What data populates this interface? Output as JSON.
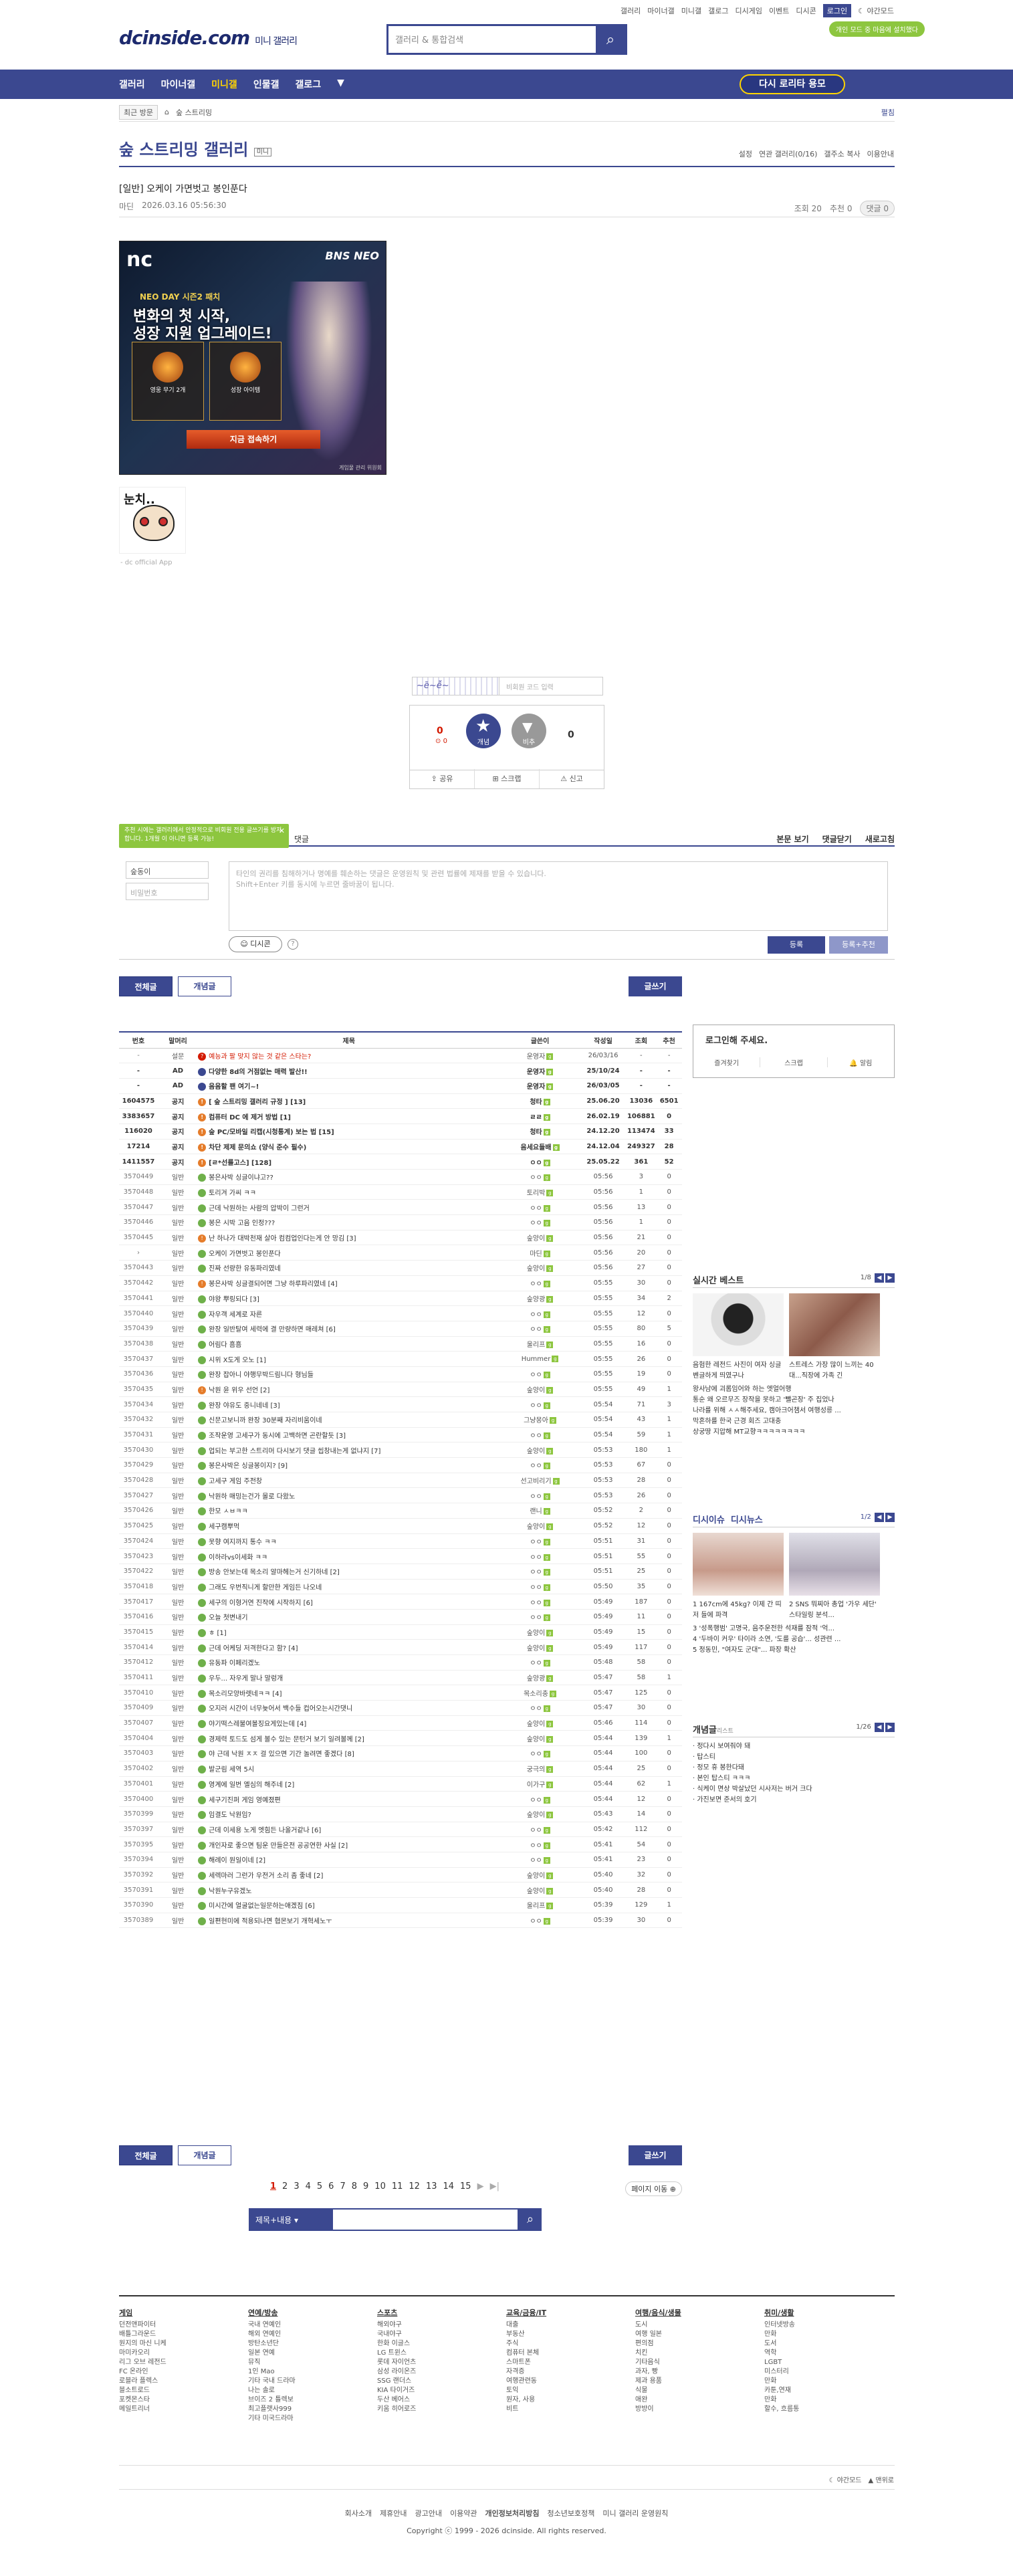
{
  "util": {
    "links": [
      "갤러리",
      "마이너갤",
      "미니갤",
      "갤로그",
      "디시게임",
      "이벤트",
      "디시콘"
    ],
    "login": "로그인",
    "night": "야간모드"
  },
  "dnd_badge": "개인 모드 중 마음에 설치했다",
  "logo": {
    "main": "dcinside.com",
    "sub": "미니 갤러리"
  },
  "search_placeholder": "갤러리 & 통합검색",
  "gnb": {
    "items": [
      "갤러리",
      "마이너갤",
      "미니갤",
      "인물갤",
      "갤로그",
      "▼"
    ],
    "active": 2,
    "retry": "다시 로리타 용모"
  },
  "lnb": {
    "recent": "최근 방문",
    "crumb": "숲 스트리밍",
    "spread": "펼침"
  },
  "gallery": {
    "title": "숲 스트리밍 갤러리",
    "badge": "미니",
    "tools": [
      "설정",
      "연관 갤러리(0/16)",
      "갤주소 복사",
      "이용안내"
    ]
  },
  "post": {
    "title": "[일반] 오케이 가면벗고 봉인푼다",
    "author": "마딘",
    "date": "2026.03.16 05:56:30",
    "views": "조회 20",
    "recs": "추천 0",
    "comments": "댓글 0"
  },
  "banner": {
    "nc": "nc",
    "bns": "BNS NEO",
    "l1": "NEO DAY 시즌2 패치",
    "l2a": "변화의 첫 시작,",
    "l2b": "성장 지원 업그레이드!",
    "c1": "영웅 무기 2개",
    "c2": "성장 아이템",
    "cta": "지금 접속하기",
    "cap": "게임물 관리 위원회"
  },
  "sticker": {
    "txt": "눈치..",
    "cap": "- dc official App"
  },
  "captcha_placeholder": "비회원 코드 입력",
  "vote": {
    "up_count": "0",
    "up_sub": "0",
    "up_label": "개념",
    "dn_label": "비추",
    "dn_count": "0"
  },
  "share": [
    "공유",
    "스크랩",
    "신고"
  ],
  "tooltip": "추천 시에는 갤러리에서 안정적으로 비회원 전용 글쓰기를 방지합니다. 1개월 이 아니면 등록 가능!",
  "cmt": {
    "header_left": "댓글",
    "sort": "본문 보기",
    "cnt": "댓글닫기",
    "refresh": "새로고침",
    "nick": "숲동이",
    "pw": "비밀번호",
    "ta1": "타인의 권리를 침해하거나 명예를 훼손하는 댓글은 운영원칙 및 관련 법률에 제재를 받을 수 있습니다.",
    "ta2": "Shift+Enter 키를 동시에 누르면 줄바꿈이 됩니다.",
    "dccon": "디시콘",
    "submit": "등록",
    "submit2": "등록+추천"
  },
  "buttons": {
    "all": "전체글",
    "best": "개념글",
    "write": "글쓰기"
  },
  "table": {
    "headers": [
      "번호",
      "말머리",
      "제목",
      "글쓴이",
      "작성일",
      "조회",
      "추천"
    ],
    "rows": [
      [
        "-",
        "설문",
        "예능과 팔 맞지 않는 것 같은 스타는?",
        "운영자",
        "26/03/16",
        "-",
        "-",
        "r",
        "red"
      ],
      [
        "-",
        "AD",
        "다양한 8d의 거점없는 매력 발산!!",
        "운영자",
        "25/10/24",
        "-",
        "-",
        "b",
        "notice"
      ],
      [
        "-",
        "AD",
        "음음할 팬 여기~!",
        "운영자",
        "26/03/05",
        "-",
        "-",
        "b",
        "notice"
      ],
      [
        "1604575",
        "공지",
        "[ 숲 스트리밍 갤러리 규정 ] [13]",
        "청타",
        "25.06.20",
        "13036",
        "6501",
        "n",
        "notice"
      ],
      [
        "3383657",
        "공지",
        "컴퓨터 DC 에 제거 방법 [1]",
        "ㄹㄹ",
        "26.02.19",
        "106881",
        "0",
        "n",
        "notice"
      ],
      [
        "116020",
        "공지",
        "숲 PC/모바일 리캡(시청통계) 보는 법 [15]",
        "청타",
        "24.12.20",
        "113474",
        "33",
        "n",
        "notice"
      ],
      [
        "17214",
        "공지",
        "차단 제제 문의쇼 (양식 준수 필수)",
        "음세요들배",
        "24.12.04",
        "249327",
        "28",
        "n",
        "notice"
      ],
      [
        "1411557",
        "공지",
        "[ㄹ*선룰고스] [128]",
        "ㅇㅇ",
        "25.05.22",
        "361",
        "52",
        "n",
        "notice"
      ],
      [
        "3570449",
        "일반",
        "봉은사박 싱글이냐고??",
        "ㅇㅇ",
        "05:56",
        "3",
        "0",
        "g",
        ""
      ],
      [
        "3570448",
        "일반",
        "토리겨 가씨 ㅋㅋ",
        "토리박",
        "05:56",
        "1",
        "0",
        "g",
        ""
      ],
      [
        "3570447",
        "일반",
        "근데 낙원하는 사람의 압박이 그런거",
        "ㅇㅇ",
        "05:56",
        "13",
        "0",
        "g",
        ""
      ],
      [
        "3570446",
        "일반",
        "봉은 시박 고음 인정???",
        "ㅇㅇ",
        "05:56",
        "1",
        "0",
        "g",
        ""
      ],
      [
        "3570445",
        "일반",
        "난 하나가 대박천재 살아 컴컴업인다는게 안 망김 [3]",
        "숲양이",
        "05:56",
        "21",
        "0",
        "n",
        ""
      ],
      [
        "›",
        "일반",
        "오케이 가면벗고 봉인푼다",
        "마딘",
        "05:56",
        "20",
        "0",
        "g",
        ""
      ],
      [
        "3570443",
        "일반",
        "진짜 선량한 유동파리였네",
        "숲양이",
        "05:56",
        "27",
        "0",
        "g",
        ""
      ],
      [
        "3570442",
        "일반",
        "봉은사박 싱글결되어면 그냥 하루파리였네 [4]",
        "ㅇㅇ",
        "05:55",
        "30",
        "0",
        "n",
        ""
      ],
      [
        "3570441",
        "일반",
        "야왕 뿌링되다 [3]",
        "숲양광",
        "05:55",
        "34",
        "2",
        "g",
        ""
      ],
      [
        "3570440",
        "일반",
        "자우객 세계로 자른",
        "ㅇㅇ",
        "05:55",
        "12",
        "0",
        "g",
        ""
      ],
      [
        "3570439",
        "일반",
        "완장 일반탈여 세력에 결 만량하면 매레쳐 [6]",
        "ㅇㅇ",
        "05:55",
        "80",
        "5",
        "g",
        ""
      ],
      [
        "3570438",
        "일반",
        "어림다 흠흠",
        "울리프",
        "05:55",
        "16",
        "0",
        "g",
        ""
      ],
      [
        "3570437",
        "일반",
        "시위 X도게 오노 [1]",
        "Hummer",
        "05:55",
        "26",
        "0",
        "g",
        ""
      ],
      [
        "3570436",
        "일반",
        "완장 잡아니 야행무박드림니다 형님들",
        "ㅇㅇ",
        "05:55",
        "19",
        "0",
        "g",
        ""
      ],
      [
        "3570435",
        "일반",
        "낙원 윤 위우 선언 [2]",
        "숲양이",
        "05:55",
        "49",
        "1",
        "n",
        ""
      ],
      [
        "3570434",
        "일반",
        "완장 야유도 중니네네 [3]",
        "ㅇㅇ",
        "05:54",
        "71",
        "3",
        "g",
        ""
      ],
      [
        "3570432",
        "일반",
        "신문고보니까 완장 30분째 자리비움이네",
        "그냥몽아",
        "05:54",
        "43",
        "1",
        "g",
        ""
      ],
      [
        "3570431",
        "일반",
        "조작운영 고세구가 동시에 고백하면 곤란할듯 [3]",
        "ㅇㅇ",
        "05:54",
        "59",
        "1",
        "g",
        ""
      ],
      [
        "3570430",
        "일반",
        "업되는 부고한 스트리머 다시보기 댓글 씹창내는게 없냐지 [7]",
        "숲양이",
        "05:53",
        "180",
        "1",
        "g",
        ""
      ],
      [
        "3570429",
        "일반",
        "봉은사박은 싱글봉이지? [9]",
        "ㅇㅇ",
        "05:53",
        "67",
        "0",
        "g",
        ""
      ],
      [
        "3570428",
        "일반",
        "고세구 게임 주전창",
        "선고비리기",
        "05:53",
        "28",
        "0",
        "g",
        ""
      ],
      [
        "3570427",
        "일반",
        "낙원하 매밍는건가 몰로 다왔노",
        "ㅇㅇ",
        "05:53",
        "26",
        "0",
        "g",
        ""
      ],
      [
        "3570426",
        "일반",
        "한모 ㅅㅂㅋㅋ",
        "랜니",
        "05:52",
        "2",
        "0",
        "g",
        ""
      ],
      [
        "3570425",
        "일반",
        "세구캠뿌먹",
        "숲양이",
        "05:52",
        "12",
        "0",
        "g",
        ""
      ],
      [
        "3570424",
        "일반",
        "못향 여지까지 통수 ㅋㅋ",
        "ㅇㅇ",
        "05:51",
        "31",
        "0",
        "g",
        ""
      ],
      [
        "3570423",
        "일반",
        "이하라vs이세화 ㅋㅋ",
        "ㅇㅇ",
        "05:51",
        "55",
        "0",
        "g",
        ""
      ],
      [
        "3570422",
        "일반",
        "방송 안보는데 목소리 알마헤는거 신기하네 [2]",
        "ㅇㅇ",
        "05:51",
        "25",
        "0",
        "g",
        ""
      ],
      [
        "3570418",
        "일반",
        "그래도 우번직니게 할만한 게임든 나오네",
        "ㅇㅇ",
        "05:50",
        "35",
        "0",
        "g",
        ""
      ],
      [
        "3570417",
        "일반",
        "세구의 이형거연 진작에 시작하지 [6]",
        "ㅇㅇ",
        "05:49",
        "187",
        "0",
        "g",
        ""
      ],
      [
        "3570416",
        "일반",
        "오늘 첫변내기",
        "ㅇㅇ",
        "05:49",
        "11",
        "0",
        "g",
        ""
      ],
      [
        "3570415",
        "일반",
        "ㅎ [1]",
        "숲양이",
        "05:49",
        "15",
        "0",
        "g",
        ""
      ],
      [
        "3570414",
        "일반",
        "근데 어케딩 저격한다고 함? [4]",
        "숲양이",
        "05:49",
        "117",
        "0",
        "g",
        ""
      ],
      [
        "3570412",
        "일반",
        "유동파 이페리겠노",
        "ㅇㅇ",
        "05:48",
        "58",
        "0",
        "g",
        ""
      ],
      [
        "3570411",
        "일반",
        "우두... 자우게 말나 말렁개",
        "숲양광",
        "05:47",
        "58",
        "1",
        "g",
        ""
      ],
      [
        "3570410",
        "일반",
        "목소리모양바렛네ㅋㅋ [4]",
        "목소리충",
        "05:47",
        "125",
        "0",
        "g",
        ""
      ],
      [
        "3570409",
        "일반",
        "오지러 시간이 너무늦어서 백수들 컵어오는시간댓니",
        "ㅇㅇ",
        "05:47",
        "30",
        "0",
        "g",
        ""
      ],
      [
        "3570407",
        "일반",
        "야기떡스레불여볼징요게있는데 [4]",
        "숲양이",
        "05:46",
        "114",
        "0",
        "g",
        ""
      ],
      [
        "3570404",
        "일반",
        "경제력 토드도 섬게 볼수 있는 문턴거 보기 일려볼께 [2]",
        "숲양이",
        "05:44",
        "139",
        "1",
        "g",
        ""
      ],
      [
        "3570403",
        "일반",
        "야 근데 낙원 ㅈㅈ 걸 있으면 기간 놀려면 좋겠다 [8]",
        "ㅇㅇ",
        "05:44",
        "100",
        "0",
        "g",
        ""
      ],
      [
        "3570402",
        "일반",
        "발군림 세역 5시",
        "궁극의",
        "05:44",
        "25",
        "0",
        "g",
        ""
      ],
      [
        "3570401",
        "일반",
        "영계에 일번 엘심의 해주네 [2]",
        "이가구",
        "05:44",
        "62",
        "1",
        "g",
        ""
      ],
      [
        "3570400",
        "일반",
        "세구기진퍼 게임 영예졌편",
        "ㅇㅇ",
        "05:44",
        "12",
        "0",
        "g",
        ""
      ],
      [
        "3570399",
        "일반",
        "임결도 낙원임?",
        "숲양이",
        "05:43",
        "14",
        "0",
        "g",
        ""
      ],
      [
        "3570397",
        "일반",
        "근데 이세용 노게 엣힘든 나올거같나 [6]",
        "ㅇㅇ",
        "05:42",
        "112",
        "0",
        "g",
        ""
      ],
      [
        "3570395",
        "일반",
        "개인자로 좋으면 팀운 만들은전 공공연한 사실 [2]",
        "ㅇㅇ",
        "05:41",
        "54",
        "0",
        "g",
        ""
      ],
      [
        "3570394",
        "일반",
        "해례이 원일이네 [2]",
        "ㅇㅇ",
        "05:41",
        "23",
        "0",
        "g",
        ""
      ],
      [
        "3570392",
        "일반",
        "세렉마러 그런가 우전거 소리 좀 좋네 [2]",
        "숲양이",
        "05:40",
        "32",
        "0",
        "g",
        ""
      ],
      [
        "3570391",
        "일반",
        "낙원누구유겠노",
        "숲양이",
        "05:40",
        "28",
        "0",
        "g",
        ""
      ],
      [
        "3570390",
        "일반",
        "미시간에 얼굴없는일문하는애겠짐 [6]",
        "울리프",
        "05:39",
        "129",
        "1",
        "g",
        ""
      ],
      [
        "3570389",
        "일반",
        "일편현미에 적용되나면 협몬보기 개혁세노ㅜ",
        "ㅇㅇ",
        "05:39",
        "30",
        "0",
        "g",
        ""
      ]
    ]
  },
  "paging": {
    "pages": [
      "1",
      "2",
      "3",
      "4",
      "5",
      "6",
      "7",
      "8",
      "9",
      "10",
      "11",
      "12",
      "13",
      "14",
      "15"
    ],
    "next": "▶",
    "last": "▶|",
    "goto": "페이지 이동 ⊕"
  },
  "bsearch": {
    "select": "제목+내용"
  },
  "login_box": {
    "title": "로그인해 주세요.",
    "items": [
      "즐겨찾기",
      "스크랩",
      "알림"
    ]
  },
  "realtime": {
    "title": "실시간 베스트",
    "page": "1/8",
    "caps": [
      "음험한 레전드 사진이 여자 싱글벤글하게 띄였구나",
      "스트레스 가장 많이 느끼는 40대...직장에 가족 긴"
    ],
    "list": [
      "왕사남에 괴롭임어와 하는 엣얼어행",
      "통순 왜 오르무즈 장작을 못하고 '뺄곤장' 주 집었나",
      "나라를 위해 ㅅㅅ해주세요, 캠아크어챔서 여행성릉 ...",
      "막혼하를 한국 근경 회즈 고대충",
      "상궁땅 지압해 MT교향ㅋㅋㅋㅋㅋㅋㅋㅋ"
    ]
  },
  "dcissue": {
    "title1": "디시이슈",
    "title2": "디시뉴스",
    "page": "1/2",
    "caps": [
      "1 167cm에 45kg? 이제 간 띠저 들에 파격",
      "2 SNS 뭐찌아 총업 '가우 세단' 스타일링 분석..."
    ],
    "list": [
      "3 '성폭행범' 고명국, 음주운전한 석재를 잠적 '억...",
      "4 '두바이 커우' 타이라 소연, '도를 공습'... 성관련 ...",
      "5 정동민, \"여자도 군대\"... 파장 확산"
    ]
  },
  "concept": {
    "title": "개념글",
    "badge": "리스트",
    "page": "1/26",
    "list": [
      "정다시 보여줘야 돼",
      "탑스티",
      "정모 휴 봉한다돼",
      "본인 탑스티 ㅋㅋㅋ",
      "식케이 면상 박살났던 시사저는 버거 크다",
      "가진보면 준서의 호기"
    ]
  },
  "footer": {
    "cols": [
      {
        "h": "게임",
        "items": [
          "던전앤파이터",
          "배틀그라운드",
          "원지의 마신 니케",
          "마미카오리",
          "리그 오브 레전드",
          "FC 온라인",
          "로블라 플렉스",
          "블소트로드",
          "포켓몬스타",
          "메일트리너"
        ]
      },
      {
        "h": "연예/방송",
        "items": [
          "국내 연예인",
          "해외 연예인",
          "방탄소년단",
          "일본 연예",
          "뮤직",
          "1인 Mao",
          "기타 국내 드라마",
          "나는 솔로",
          "브이즈 2 틀렉보",
          "최고플랫사999",
          "기타 미국드라마"
        ]
      },
      {
        "h": "스포츠",
        "items": [
          "해외야구",
          "국내야구",
          "한화 이글스",
          "LG 트윈스",
          "롯데 자이언츠",
          "삼성 라이온즈",
          "SSG 랜더스",
          "KIA 타이거즈",
          "두산 베어스",
          "키움 히어로즈"
        ]
      },
      {
        "h": "교육/금융/IT",
        "items": [
          "대출",
          "부동산",
          "주식",
          "컴퓨터 본체",
          "스마트폰",
          "자격증",
          "여행관련동",
          "토익",
          "원자, 사용",
          "비트"
        ]
      },
      {
        "h": "여행/음식/생물",
        "items": [
          "도시",
          "여행 일본",
          "편의점",
          "치킨",
          "기타음식",
          "과자, 빵",
          "제과 용품",
          "식물",
          "애완",
          "방방이"
        ]
      },
      {
        "h": "취미/생활",
        "items": [
          "인터넷방송",
          "만화",
          "도서",
          "역학",
          "LGBT",
          "미스터리",
          "만화",
          "카툰,연재",
          "만화",
          "할수, 흐름통"
        ]
      }
    ]
  },
  "flinks": [
    "야간모드",
    "맨위로"
  ],
  "fbottom": [
    "회사소개",
    "제휴안내",
    "광고안내",
    "이용약관",
    "개인정보처리방침",
    "청소년보호정책",
    "미니 갤러리 운영원칙"
  ],
  "copy": "Copyright ⓒ 1999 - 2026 dcinside. All rights reserved."
}
